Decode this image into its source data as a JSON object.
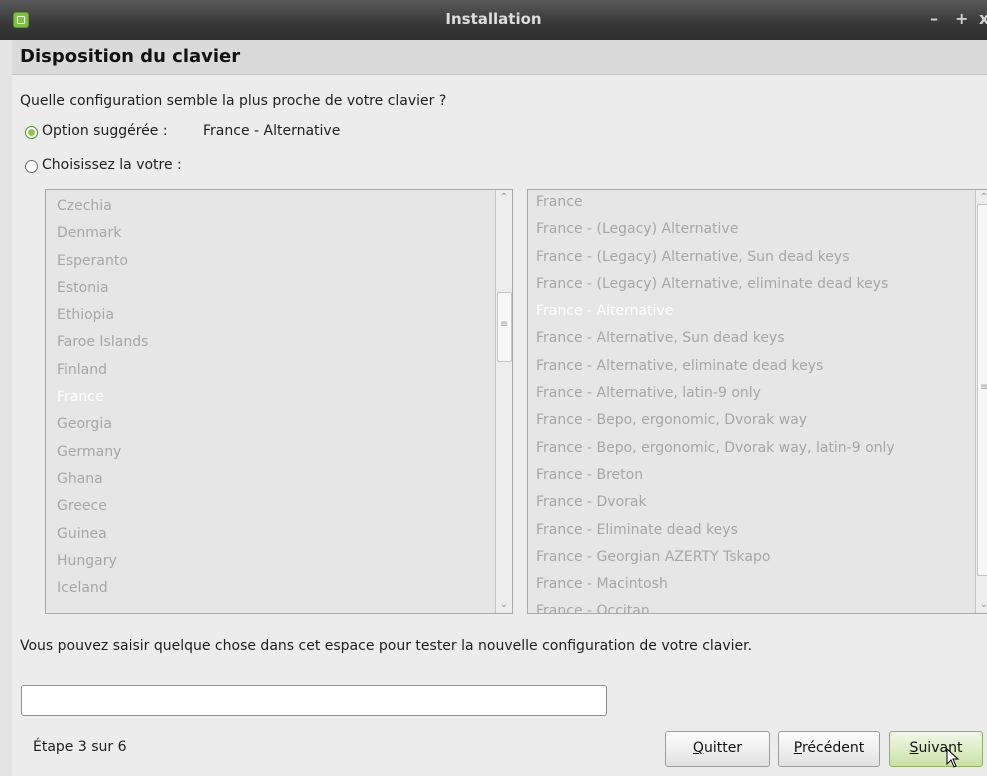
{
  "window": {
    "title": "Installation",
    "minimize": "–",
    "maximize": "+",
    "close": "x"
  },
  "page_title": "Disposition du clavier",
  "question": "Quelle configuration semble la plus proche de votre clavier ?",
  "option_suggested": {
    "label": "Option suggérée :",
    "value": "France - Alternative",
    "checked": true
  },
  "option_choose": {
    "label": "Choisissez la votre :",
    "checked": false
  },
  "countries": {
    "items": [
      "Czechia",
      "Denmark",
      "Esperanto",
      "Estonia",
      "Ethiopia",
      "Faroe Islands",
      "Finland",
      "France",
      "Georgia",
      "Germany",
      "Ghana",
      "Greece",
      "Guinea",
      "Hungary",
      "Iceland"
    ],
    "selected": "France"
  },
  "variants": {
    "items": [
      "France",
      "France - (Legacy) Alternative",
      "France - (Legacy) Alternative, Sun dead keys",
      "France - (Legacy) Alternative, eliminate dead keys",
      "France - Alternative",
      "France - Alternative, Sun dead keys",
      "France - Alternative, eliminate dead keys",
      "France - Alternative, latin-9 only",
      "France - Bepo, ergonomic, Dvorak way",
      "France - Bepo, ergonomic, Dvorak way, latin-9 only",
      "France - Breton",
      "France - Dvorak",
      "France - Eliminate dead keys",
      "France - Georgian AZERTY Tskapo",
      "France - Macintosh",
      "France - Occitan"
    ],
    "selected": "France - Alternative"
  },
  "test_hint": "Vous pouvez saisir quelque chose dans cet espace pour tester la nouvelle configuration de votre clavier.",
  "test_input": {
    "value": "",
    "placeholder": ""
  },
  "footer": {
    "step": "Étape 3 sur 6",
    "quit": {
      "mnemonic": "Q",
      "rest": "uitter"
    },
    "previous": {
      "mnemonic": "P",
      "rest": "récédent"
    },
    "next": {
      "mnemonic": "S",
      "rest": "uivant"
    }
  },
  "colors": {
    "accent": "#8cc84b",
    "titlebar": "#3a3a3a",
    "list_text": "#a6a6a6"
  }
}
